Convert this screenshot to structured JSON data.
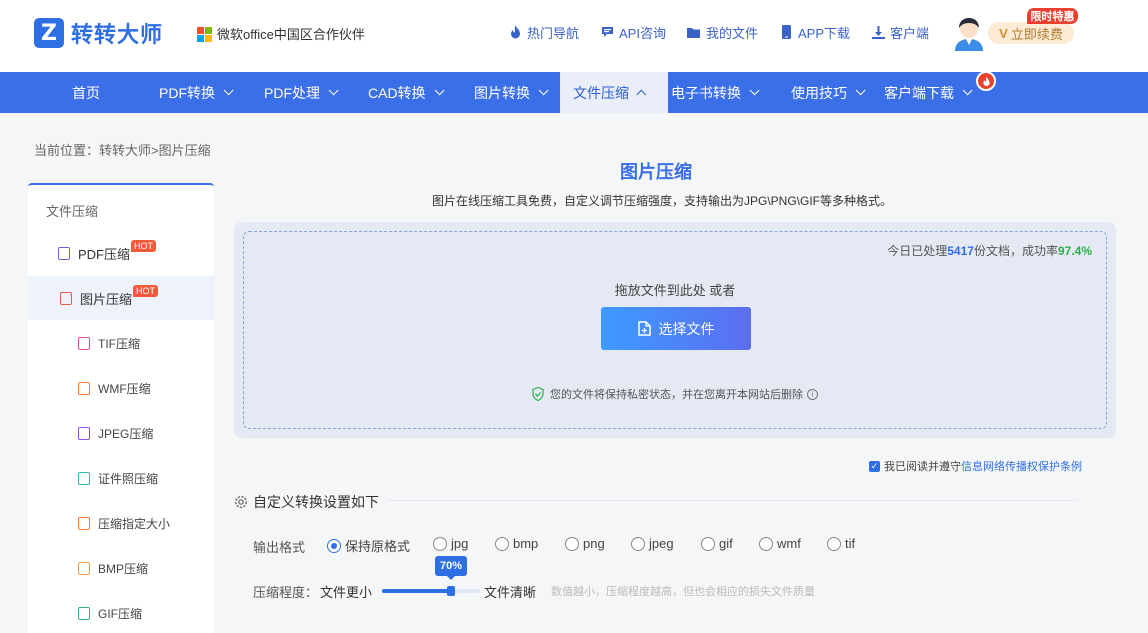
{
  "header": {
    "logo_mark": "Z",
    "logo_text": "转转大师",
    "partner_text": "微软office中国区合作伙伴",
    "links": [
      {
        "label": "热门导航",
        "icon": "flame-icon"
      },
      {
        "label": "API咨询",
        "icon": "chat-icon"
      },
      {
        "label": "我的文件",
        "icon": "folder-icon"
      },
      {
        "label": "APP下载",
        "icon": "phone-icon"
      },
      {
        "label": "客户端",
        "icon": "download-icon"
      }
    ],
    "renew_label": "立即续费",
    "promo_label": "限时特惠"
  },
  "nav": {
    "items": [
      {
        "label": "首页",
        "chevron": false
      },
      {
        "label": "PDF转换",
        "chevron": true
      },
      {
        "label": "PDF处理",
        "chevron": true
      },
      {
        "label": "CAD转换",
        "chevron": true
      },
      {
        "label": "图片转换",
        "chevron": true
      },
      {
        "label": "文件压缩",
        "chevron": true,
        "active": true
      },
      {
        "label": "电子书转换",
        "chevron": true
      },
      {
        "label": "使用技巧",
        "chevron": true
      },
      {
        "label": "客户端下载",
        "chevron": true
      }
    ]
  },
  "breadcrumb": "当前位置：转转大师>图片压缩",
  "sidebar": {
    "title": "文件压缩",
    "items": [
      {
        "label": "PDF压缩",
        "level": "main",
        "hot": "HOT",
        "icon_color": "#7a5cd6"
      },
      {
        "label": "图片压缩",
        "level": "main",
        "hot": "HOT",
        "icon_color": "#e45a4a",
        "active": true
      },
      {
        "label": "TIF压缩",
        "level": "sub",
        "icon_color": "#d94fa0"
      },
      {
        "label": "WMF压缩",
        "level": "sub",
        "icon_color": "#f07b42"
      },
      {
        "label": "JPEG压缩",
        "level": "sub",
        "icon_color": "#8a56d9"
      },
      {
        "label": "证件照压缩",
        "level": "sub",
        "icon_color": "#2fb8b0"
      },
      {
        "label": "压缩指定大小",
        "level": "sub",
        "icon_color": "#f07b42"
      },
      {
        "label": "BMP压缩",
        "level": "sub",
        "icon_color": "#f0a050"
      },
      {
        "label": "GIF压缩",
        "level": "sub",
        "icon_color": "#3fb37a"
      }
    ]
  },
  "main": {
    "title": "图片压缩",
    "subtitle": "图片在线压缩工具免费，自定义调节压缩强度，支持输出为JPG\\PNG\\GIF等多种格式。",
    "stats_prefix": "今日已处理",
    "stats_count": "5417",
    "stats_mid": "份文档，成功率",
    "stats_rate": "97.4%",
    "drop_text": "拖放文件到此处 或者",
    "choose_label": "选择文件",
    "privacy_text": "您的文件将保持私密状态，并在您离开本网站后删除",
    "agree_prefix": "我已阅读并遵守",
    "agree_link": "信息网络传播权保护条例",
    "settings_title": "自定义转换设置如下",
    "format_label": "输出格式",
    "formats": [
      {
        "label": "保持原格式",
        "selected": true
      },
      {
        "label": "jpg"
      },
      {
        "label": "bmp"
      },
      {
        "label": "png"
      },
      {
        "label": "jpeg"
      },
      {
        "label": "gif"
      },
      {
        "label": "wmf"
      },
      {
        "label": "tif"
      }
    ],
    "compress_label": "压缩程度：",
    "slider_left": "文件更小",
    "slider_right": "文件清晰",
    "slider_value": "70%",
    "slider_level": 0.7,
    "hint": "数值越小，压缩程度越高，但也会相应的损失文件质量"
  },
  "colors": {
    "accent": "#3a6fe8",
    "nav_bg": "#3a6fe8",
    "success": "#2db04a"
  }
}
